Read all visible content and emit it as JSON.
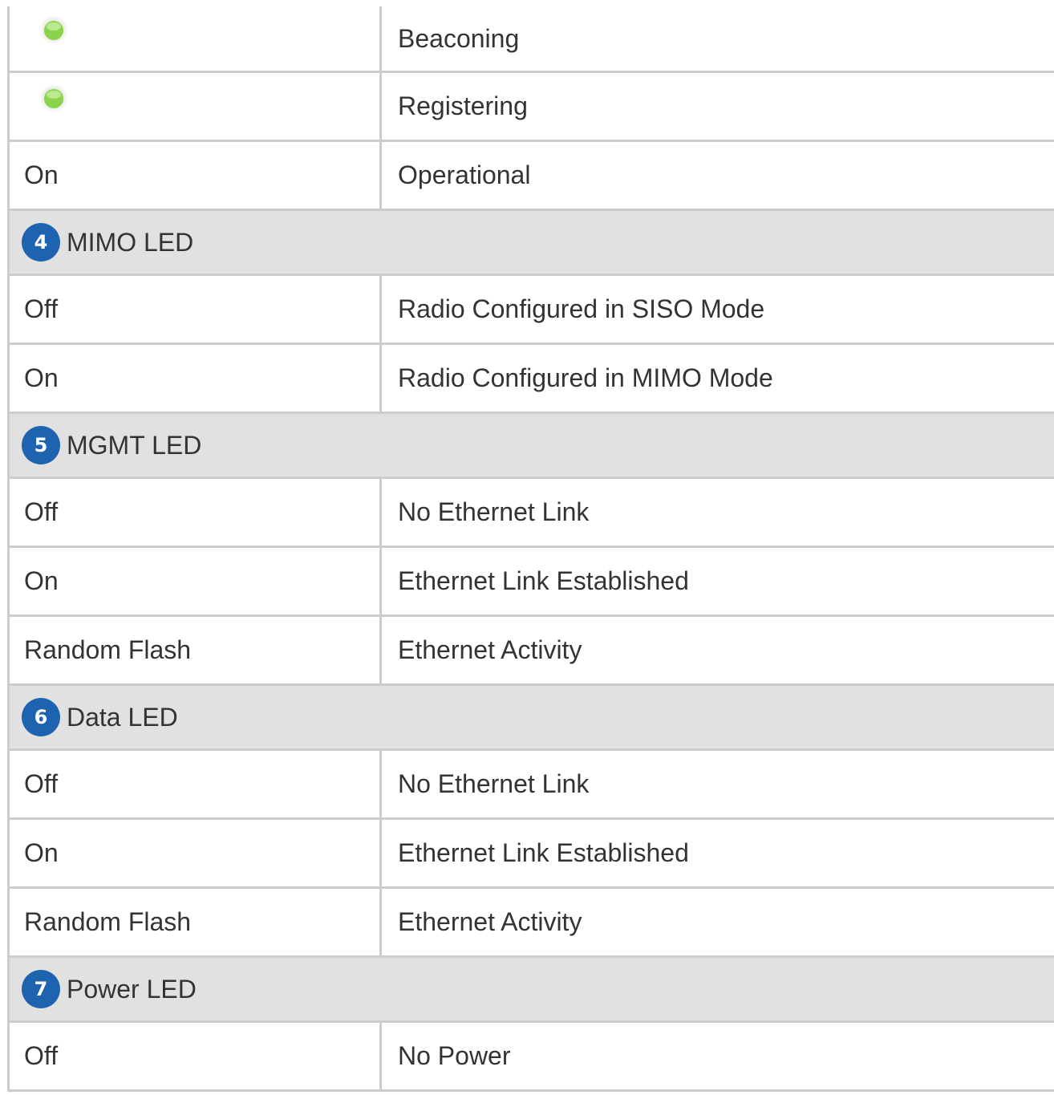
{
  "colors": {
    "badge": "#1d63b0",
    "led_green": "#8bd34a",
    "section_bg": "#e1e1e1",
    "border": "#cccccc",
    "text": "#333333"
  },
  "rows": [
    {
      "type": "data",
      "state": "",
      "state_icon": "green-led-icon",
      "description": "Beaconing"
    },
    {
      "type": "data",
      "state": "",
      "state_icon": "green-led-icon",
      "description": "Registering"
    },
    {
      "type": "data",
      "state": "On",
      "description": "Operational"
    },
    {
      "type": "section",
      "number": "4",
      "title": "MIMO LED"
    },
    {
      "type": "data",
      "state": "Off",
      "description": "Radio Configured in SISO Mode"
    },
    {
      "type": "data",
      "state": "On",
      "description": "Radio Configured in MIMO Mode"
    },
    {
      "type": "section",
      "number": "5",
      "title": "MGMT LED"
    },
    {
      "type": "data",
      "state": "Off",
      "description": "No Ethernet Link"
    },
    {
      "type": "data",
      "state": "On",
      "description": "Ethernet Link Established"
    },
    {
      "type": "data",
      "state": "Random Flash",
      "description": "Ethernet Activity"
    },
    {
      "type": "section",
      "number": "6",
      "title": "Data LED"
    },
    {
      "type": "data",
      "state": "Off",
      "description": "No Ethernet Link"
    },
    {
      "type": "data",
      "state": "On",
      "description": "Ethernet Link Established"
    },
    {
      "type": "data",
      "state": "Random Flash",
      "description": "Ethernet Activity"
    },
    {
      "type": "section",
      "number": "7",
      "title": "Power LED"
    },
    {
      "type": "data",
      "state": "Off",
      "description": "No Power"
    }
  ]
}
